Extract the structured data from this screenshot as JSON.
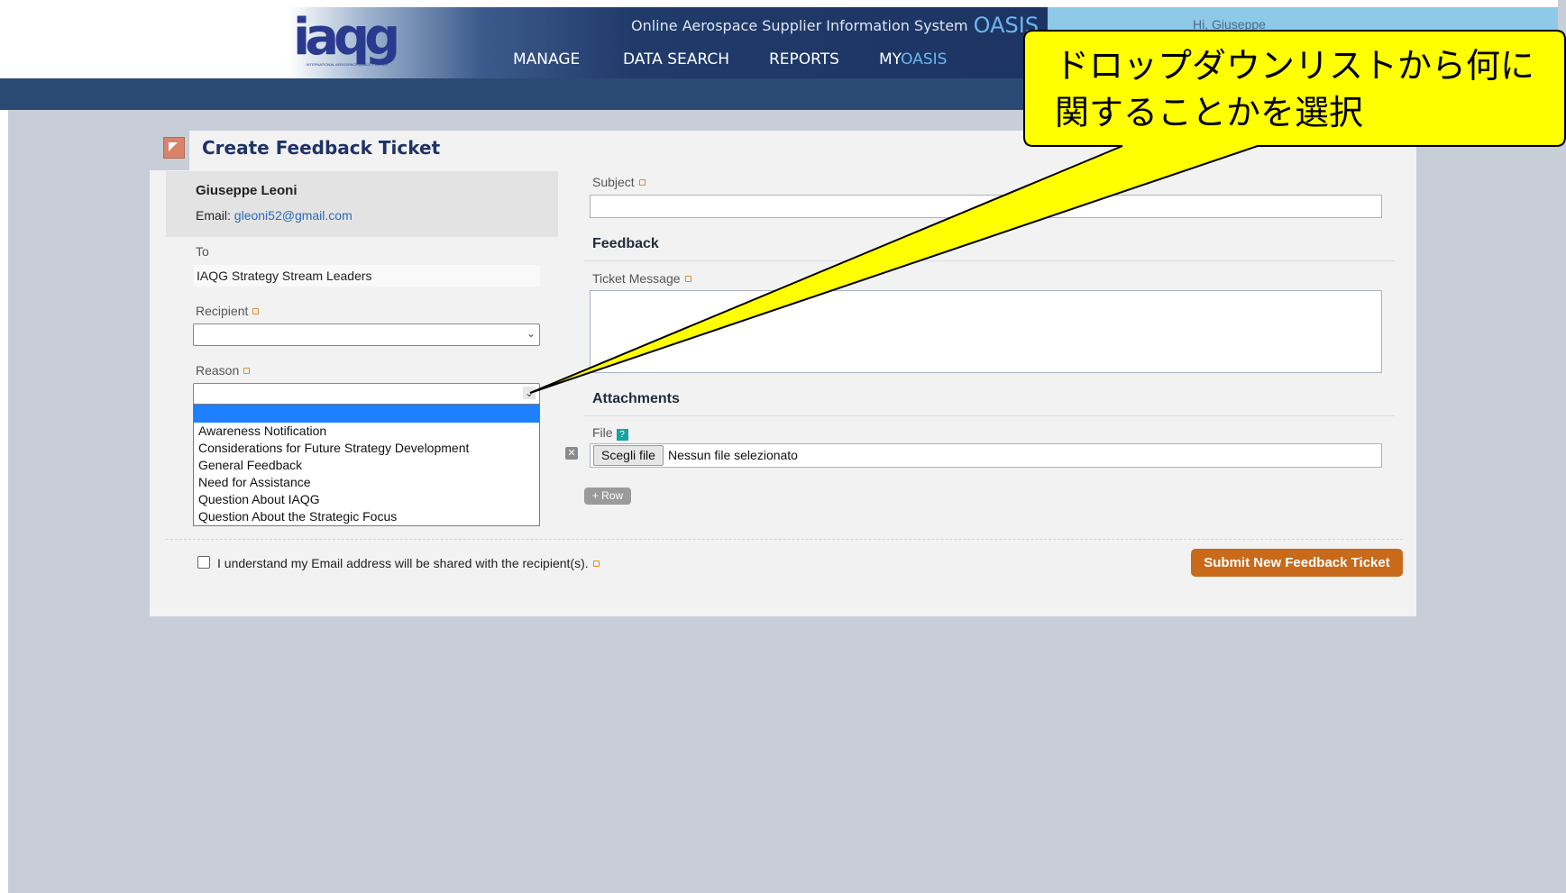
{
  "header": {
    "logo_text": "iaqg",
    "logo_subtext": "INTERNATIONAL AEROSPACE QUALITY GROUP",
    "system_name": "Online Aerospace Supplier Information System",
    "brand": "OASIS",
    "nav": {
      "manage": "MANAGE",
      "data_search": "DATA SEARCH",
      "reports": "REPORTS",
      "my_prefix": "MY",
      "my_suffix": "OASIS"
    },
    "greeting": "Hi, Giuseppe"
  },
  "form": {
    "title": "Create Feedback Ticket",
    "user": {
      "name": "Giuseppe Leoni",
      "email_label": "Email:",
      "email": "gleoni52@gmail.com"
    },
    "to_label": "To",
    "to_value": "IAQG Strategy Stream Leaders",
    "recipient_label": "Recipient",
    "recipient_value": "",
    "reason_label": "Reason",
    "reason_value": "",
    "reason_options": [
      "Awareness Notification",
      "Considerations for Future Strategy Development",
      "General Feedback",
      "Need for Assistance",
      "Question About IAQG",
      "Question About the Strategic Focus"
    ],
    "subject_label": "Subject",
    "subject_value": "",
    "feedback_heading": "Feedback",
    "message_label": "Ticket Message",
    "message_value": "",
    "attachments_heading": "Attachments",
    "file_label": "File",
    "help_glyph": "?",
    "file_button": "Scegli file",
    "file_status": "Nessun file selezionato",
    "remove_glyph": "✕",
    "add_row": "+ Row",
    "agree_text": "I understand my Email address will be shared with the recipient(s).",
    "submit": "Submit New Feedback Ticket"
  },
  "callout": {
    "line1": "ドロップダウンリストから何に",
    "line2": "関することかを選択",
    "fill": "#ffff00",
    "stroke": "#000000"
  },
  "colors": {
    "nav_bar": "#2b4a73",
    "submit": "#c86a1a",
    "link": "#2b6bb3",
    "title": "#1f3366",
    "highlight": "#1e80ff"
  }
}
